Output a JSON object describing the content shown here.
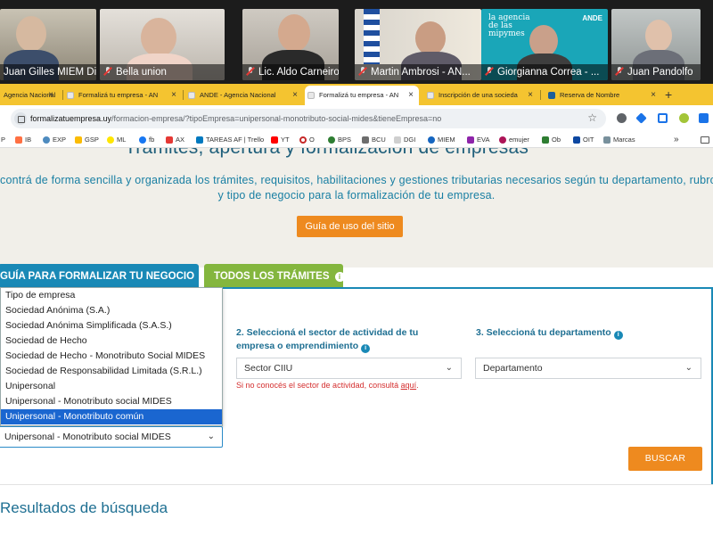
{
  "video_call": {
    "participants": [
      {
        "name": "Juan Gilles MIEM Din...",
        "muted": false
      },
      {
        "name": "Bella union",
        "muted": true
      },
      {
        "name": "Lic. Aldo Carneiro",
        "muted": true
      },
      {
        "name": "Martin Ambrosi - AN...",
        "muted": true
      },
      {
        "name": "Giorgianna Correa - ...",
        "muted": true,
        "slide_text": "la agencia de las mipymes",
        "slide_logo": "ANDE"
      },
      {
        "name": "Juan Pandolfo",
        "muted": true
      }
    ]
  },
  "browser": {
    "tabs": [
      {
        "label": "Agencia Nacional",
        "active": false
      },
      {
        "label": "Formalizá tu empresa - AN",
        "active": false
      },
      {
        "label": "ANDE - Agencia Nacional",
        "active": false
      },
      {
        "label": "Formalizá tu empresa - AN",
        "active": true
      },
      {
        "label": "Inscripción de una socieda",
        "active": false
      },
      {
        "label": "Reserva de Nombre",
        "active": false
      }
    ],
    "tab_close_glyph": "×",
    "new_tab_glyph": "+",
    "url_host": "formalizatuempresa.uy",
    "url_path": "/formacion-empresa/?tipoEmpresa=unipersonal-monotributo-social-mides&tieneEmpresa=no",
    "bookmarks": [
      "P",
      "IB",
      "EXP",
      "GSP",
      "ML",
      "fb",
      "AX",
      "TAREAS AF | Trello",
      "YT",
      "O",
      "BPS",
      "BCU",
      "DGI",
      "MIEM",
      "EVA",
      "emujer",
      "Ob",
      "OIT",
      "Marcas"
    ],
    "bookmark_overflow": "»",
    "ext_colors": [
      "#5f6368",
      "#1a73e8",
      "#1a73e8",
      "#34a853",
      "#fbbc04",
      "#1a73e8"
    ]
  },
  "page": {
    "hero_title": "Trámites, apertura y formalización de empresas",
    "hero_desc_line1": "contrá de forma sencilla y organizada los trámites, requisitos, habilitaciones y gestiones tributarias necesarios según tu departamento, rubro",
    "hero_desc_line2": "y tipo de negocio para la formalización de tu empresa.",
    "guide_button": "Guía de uso del sitio",
    "tab_guide": "GUÍA PARA FORMALIZAR TU NEGOCIO",
    "tab_all": "TODOS LOS TRÁMITES",
    "info_glyph": "i",
    "step2_label_line1": "2. Seleccioná el sector de actividad de tu",
    "step2_label_line2": "empresa o emprendimiento",
    "step3_label": "3. Seleccioná tu departamento",
    "sector_placeholder": "Sector CIIU",
    "department_placeholder": "Departamento",
    "ciiu_hint_text": "Si no conocés el sector de actividad, consultá ",
    "ciiu_hint_link": "aquí",
    "ciiu_hint_end": ".",
    "company_type_options": [
      "Tipo de empresa",
      "Sociedad Anónima (S.A.)",
      "Sociedad Anónima Simplificada (S.A.S.)",
      "Sociedad de Hecho",
      "Sociedad de Hecho - Monotributo Social MIDES",
      "Sociedad de Responsabilidad Limitada (S.R.L.)",
      "Unipersonal",
      "Unipersonal - Monotributo social MIDES",
      "Unipersonal - Monotributo común"
    ],
    "highlighted_option_index": 8,
    "company_type_selected": "Unipersonal - Monotributo social MIDES",
    "chevron_glyph": "⌄",
    "search_button": "BUSCAR",
    "results_title": "Resultados de búsqueda",
    "colors": {
      "primary_blue": "#1989b6",
      "orange": "#ee8a1f",
      "green": "#84b63e",
      "error_red": "#d42f2f",
      "selection_blue": "#1a66d0",
      "tab_bar_yellow": "#f4c430"
    }
  }
}
